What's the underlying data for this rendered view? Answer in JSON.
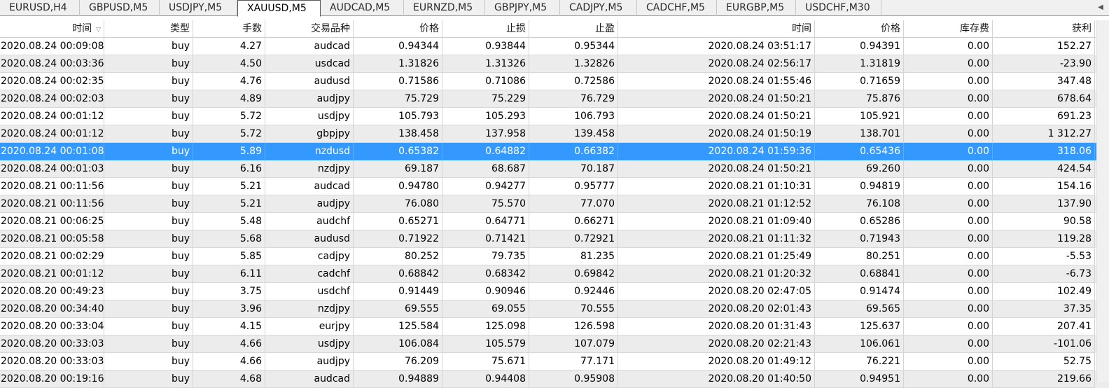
{
  "tabs": [
    {
      "label": "EURUSD,H4"
    },
    {
      "label": "GBPUSD,M5"
    },
    {
      "label": "USDJPY,M5"
    },
    {
      "label": "XAUUSD,M5"
    },
    {
      "label": "AUDCAD,M5"
    },
    {
      "label": "EURNZD,M5"
    },
    {
      "label": "GBPJPY,M5"
    },
    {
      "label": "CADJPY,M5"
    },
    {
      "label": "CADCHF,M5"
    },
    {
      "label": "EURGBP,M5"
    },
    {
      "label": "USDCHF,M30"
    }
  ],
  "active_tab": "XAUUSD,M5",
  "tab_scroll_icon": "triangle-left-icon",
  "columns": [
    "时间",
    "类型",
    "手数",
    "交易品种",
    "价格",
    "止损",
    "止盈",
    "时间",
    "价格",
    "库存费",
    "获利"
  ],
  "sort_icon": "sort-down-icon",
  "selected_row_index": 6,
  "rows": [
    [
      "2020.08.24 00:09:08",
      "buy",
      "4.27",
      "audcad",
      "0.94344",
      "0.93844",
      "0.95344",
      "2020.08.24 03:51:17",
      "0.94391",
      "0.00",
      "152.27"
    ],
    [
      "2020.08.24 00:03:36",
      "buy",
      "4.50",
      "usdcad",
      "1.31826",
      "1.31326",
      "1.32826",
      "2020.08.24 02:56:17",
      "1.31819",
      "0.00",
      "-23.90"
    ],
    [
      "2020.08.24 00:02:35",
      "buy",
      "4.76",
      "audusd",
      "0.71586",
      "0.71086",
      "0.72586",
      "2020.08.24 01:55:46",
      "0.71659",
      "0.00",
      "347.48"
    ],
    [
      "2020.08.24 00:02:03",
      "buy",
      "4.89",
      "audjpy",
      "75.729",
      "75.229",
      "76.729",
      "2020.08.24 01:50:21",
      "75.876",
      "0.00",
      "678.64"
    ],
    [
      "2020.08.24 00:01:12",
      "buy",
      "5.72",
      "usdjpy",
      "105.793",
      "105.293",
      "106.793",
      "2020.08.24 01:50:21",
      "105.921",
      "0.00",
      "691.23"
    ],
    [
      "2020.08.24 00:01:12",
      "buy",
      "5.72",
      "gbpjpy",
      "138.458",
      "137.958",
      "139.458",
      "2020.08.24 01:50:19",
      "138.701",
      "0.00",
      "1 312.27"
    ],
    [
      "2020.08.24 00:01:08",
      "buy",
      "5.89",
      "nzdusd",
      "0.65382",
      "0.64882",
      "0.66382",
      "2020.08.24 01:59:36",
      "0.65436",
      "0.00",
      "318.06"
    ],
    [
      "2020.08.24 00:01:03",
      "buy",
      "6.16",
      "nzdjpy",
      "69.187",
      "68.687",
      "70.187",
      "2020.08.24 01:50:21",
      "69.260",
      "0.00",
      "424.54"
    ],
    [
      "2020.08.21 00:11:56",
      "buy",
      "5.21",
      "audcad",
      "0.94780",
      "0.94277",
      "0.95777",
      "2020.08.21 01:10:31",
      "0.94819",
      "0.00",
      "154.16"
    ],
    [
      "2020.08.21 00:11:56",
      "buy",
      "5.21",
      "audjpy",
      "76.080",
      "75.570",
      "77.070",
      "2020.08.21 01:12:52",
      "76.108",
      "0.00",
      "137.90"
    ],
    [
      "2020.08.21 00:06:25",
      "buy",
      "5.48",
      "audchf",
      "0.65271",
      "0.64771",
      "0.66271",
      "2020.08.21 01:09:40",
      "0.65286",
      "0.00",
      "90.58"
    ],
    [
      "2020.08.21 00:05:58",
      "buy",
      "5.68",
      "audusd",
      "0.71922",
      "0.71421",
      "0.72921",
      "2020.08.21 01:11:32",
      "0.71943",
      "0.00",
      "119.28"
    ],
    [
      "2020.08.21 00:02:29",
      "buy",
      "5.85",
      "cadjpy",
      "80.252",
      "79.735",
      "81.235",
      "2020.08.21 01:25:49",
      "80.251",
      "0.00",
      "-5.53"
    ],
    [
      "2020.08.21 00:01:12",
      "buy",
      "6.11",
      "cadchf",
      "0.68842",
      "0.68342",
      "0.69842",
      "2020.08.21 01:20:32",
      "0.68841",
      "0.00",
      "-6.73"
    ],
    [
      "2020.08.20 00:49:23",
      "buy",
      "3.75",
      "usdchf",
      "0.91449",
      "0.90946",
      "0.92446",
      "2020.08.20 02:47:05",
      "0.91474",
      "0.00",
      "102.49"
    ],
    [
      "2020.08.20 00:34:40",
      "buy",
      "3.96",
      "nzdjpy",
      "69.555",
      "69.055",
      "70.555",
      "2020.08.20 02:01:43",
      "69.565",
      "0.00",
      "37.35"
    ],
    [
      "2020.08.20 00:33:04",
      "buy",
      "4.15",
      "eurjpy",
      "125.584",
      "125.098",
      "126.598",
      "2020.08.20 01:31:43",
      "125.637",
      "0.00",
      "207.41"
    ],
    [
      "2020.08.20 00:33:03",
      "buy",
      "4.66",
      "usdjpy",
      "106.084",
      "105.579",
      "107.079",
      "2020.08.20 02:21:43",
      "106.061",
      "0.00",
      "-101.06"
    ],
    [
      "2020.08.20 00:33:03",
      "buy",
      "4.66",
      "audjpy",
      "76.209",
      "75.671",
      "77.171",
      "2020.08.20 01:49:12",
      "76.221",
      "0.00",
      "52.75"
    ],
    [
      "2020.08.20 00:19:16",
      "buy",
      "4.68",
      "audcad",
      "0.94889",
      "0.94408",
      "0.95908",
      "2020.08.20 01:40:50",
      "0.94951",
      "0.00",
      "219.66"
    ]
  ],
  "colors": {
    "selection": "#3399ff",
    "alt_row": "#ececec",
    "tabbar": "#f0f0f0"
  }
}
